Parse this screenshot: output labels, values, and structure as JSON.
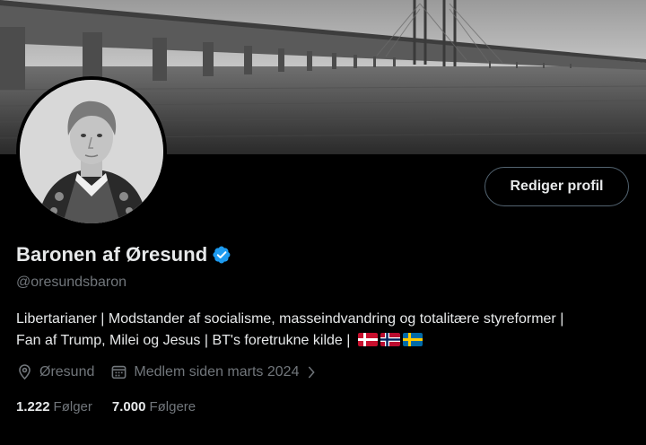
{
  "profile": {
    "name": "Baronen af Øresund",
    "handle": "@oresundsbaron",
    "bio": "Libertarianer | Modstander af socialisme, masseindvandring og totalitære styreformer | Fan af Trump, Milei og Jesus | BT's foretrukne kilde |",
    "bio_flags": [
      "denmark-flag",
      "norway-flag",
      "sweden-flag"
    ],
    "location": "Øresund",
    "joined": "Medlem siden marts 2024",
    "verified_color": "#1d9bf0"
  },
  "actions": {
    "edit_profile_label": "Rediger profil"
  },
  "stats": {
    "following_count": "1.222",
    "following_label": "Følger",
    "followers_count": "7.000",
    "followers_label": "Følgere"
  },
  "icons": {
    "location": "location-pin-icon",
    "calendar": "calendar-icon",
    "chevron": "chevron-right-icon",
    "verified": "verified-badge-icon"
  }
}
